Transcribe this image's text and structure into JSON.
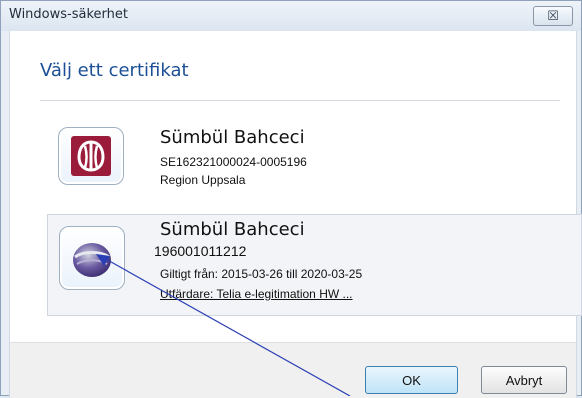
{
  "window": {
    "title": "Windows-säkerhet",
    "close_glyph": "☒"
  },
  "heading": "Välj ett certifikat",
  "certificates": [
    {
      "name": "Sümbül Bahceci",
      "id": "SE162321000024-0005196",
      "organization": "Region Uppsala",
      "icon": "region-uppsala-logo-icon"
    },
    {
      "name": "Sümbül Bahceci",
      "id": "196001011212",
      "validity": "Giltigt från: 2015-03-26 till 2020-03-25",
      "issuer": "Utfärdare: Telia e-legitimation HW ...",
      "icon": "telia-logo-icon",
      "selected": true
    }
  ],
  "buttons": {
    "ok": "OK",
    "cancel": "Avbryt"
  },
  "colors": {
    "heading": "#1c4f96",
    "uppsala": "#9b1b3a",
    "telia": "#5b3a8f",
    "annotation_arrow": "#2a3fb4"
  }
}
